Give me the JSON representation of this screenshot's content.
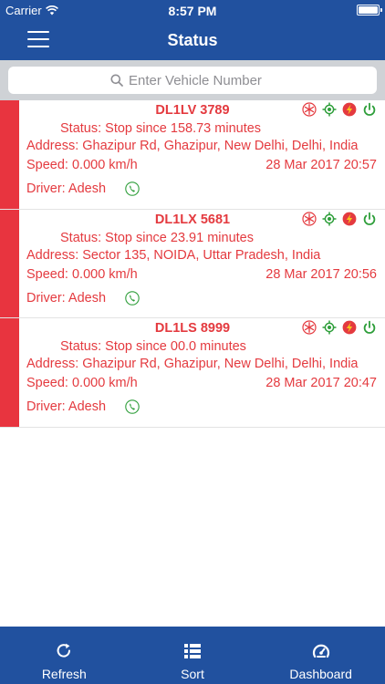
{
  "status_bar": {
    "carrier": "Carrier",
    "time": "8:57 PM",
    "battery_level": 1.0
  },
  "nav": {
    "title": "Status"
  },
  "search": {
    "placeholder": "Enter Vehicle Number",
    "value": ""
  },
  "vehicles": [
    {
      "number": "DL1LV 3789",
      "status": "Status: Stop since 158.73 minutes",
      "address": "Address: Ghazipur Rd, Ghazipur, New Delhi, Delhi, India",
      "speed": "Speed: 0.000 km/h",
      "datetime": "28 Mar 2017 20:57",
      "driver": "Driver: Adesh"
    },
    {
      "number": "DL1LX 5681",
      "status": "Status: Stop since 23.91 minutes",
      "address": "Address: Sector 135, NOIDA, Uttar Pradesh, India",
      "speed": "Speed: 0.000 km/h",
      "datetime": "28 Mar 2017 20:56",
      "driver": "Driver: Adesh"
    },
    {
      "number": "DL1LS 8999",
      "status": "Status: Stop since 00.0 minutes",
      "address": "Address: Ghazipur Rd, Ghazipur, New Delhi, Delhi, India",
      "speed": "Speed: 0.000 km/h",
      "datetime": "28 Mar 2017 20:47",
      "driver": "Driver: Adesh"
    }
  ],
  "icons": {
    "row_status": [
      "ac-snowflake-icon",
      "gps-target-icon",
      "ignition-bolt-icon",
      "power-icon"
    ],
    "phone": "phone-icon"
  },
  "colors": {
    "brand_blue": "#21519f",
    "alert_red": "#e43a3f",
    "stripe_red": "#e8343f",
    "online_green": "#2e9e3a"
  },
  "tabs": [
    {
      "label": "Refresh",
      "icon": "refresh-icon"
    },
    {
      "label": "Sort",
      "icon": "sort-list-icon"
    },
    {
      "label": "Dashboard",
      "icon": "dashboard-gauge-icon"
    }
  ]
}
